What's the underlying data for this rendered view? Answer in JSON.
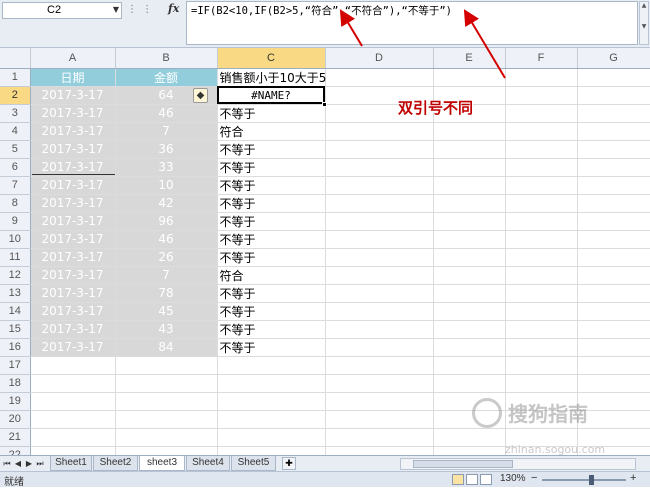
{
  "formula_bar": {
    "name_box": "C2",
    "formula": "=IF(B2<10,IF(B2>5,“符合”,“不符合”),“不等于”)",
    "fx_label": "fx"
  },
  "columns": [
    "A",
    "B",
    "C",
    "D",
    "E",
    "F",
    "G"
  ],
  "active": {
    "column": "C",
    "row": 2
  },
  "header_row": {
    "a": "日期",
    "b": "金额",
    "c": "销售额小于10大于5"
  },
  "rows": [
    {
      "num": "2",
      "date": "2017-3-17",
      "amount": "64",
      "result": "#NAME?"
    },
    {
      "num": "3",
      "date": "2017-3-17",
      "amount": "46",
      "result": "不等于"
    },
    {
      "num": "4",
      "date": "2017-3-17",
      "amount": "7",
      "result": "符合"
    },
    {
      "num": "5",
      "date": "2017-3-17",
      "amount": "36",
      "result": "不等于"
    },
    {
      "num": "6",
      "date": "2017-3-17",
      "amount": "33",
      "result": "不等于"
    },
    {
      "num": "7",
      "date": "2017-3-17",
      "amount": "10",
      "result": "不等于"
    },
    {
      "num": "8",
      "date": "2017-3-17",
      "amount": "42",
      "result": "不等于"
    },
    {
      "num": "9",
      "date": "2017-3-17",
      "amount": "96",
      "result": "不等于"
    },
    {
      "num": "10",
      "date": "2017-3-17",
      "amount": "46",
      "result": "不等于"
    },
    {
      "num": "11",
      "date": "2017-3-17",
      "amount": "26",
      "result": "不等于"
    },
    {
      "num": "12",
      "date": "2017-3-17",
      "amount": "7",
      "result": "符合"
    },
    {
      "num": "13",
      "date": "2017-3-17",
      "amount": "78",
      "result": "不等于"
    },
    {
      "num": "14",
      "date": "2017-3-17",
      "amount": "45",
      "result": "不等于"
    },
    {
      "num": "15",
      "date": "2017-3-17",
      "amount": "43",
      "result": "不等于"
    },
    {
      "num": "16",
      "date": "2017-3-17",
      "amount": "84",
      "result": "不等于"
    }
  ],
  "empty_rows": [
    "17",
    "18",
    "19",
    "20",
    "21",
    "22"
  ],
  "first_row_num": "1",
  "annotation": "双引号不同",
  "sheet_tabs": [
    "Sheet1",
    "Sheet2",
    "sheet3",
    "Sheet4",
    "Sheet5"
  ],
  "active_sheet": "sheet3",
  "status": {
    "ready": "就绪",
    "zoom": "130%",
    "zoom_minus": "−",
    "zoom_plus": "+"
  },
  "watermark": {
    "main": "搜狗指南",
    "sub": "zhinan.sogou.com"
  },
  "icons": {
    "error": "warning-diamond-icon",
    "dropdown": "chevron-down-icon",
    "new_sheet": "insert-sheet-icon"
  },
  "colors": {
    "header_fill": "#92cddc",
    "data_fill": "#d8d8d8",
    "active_header": "#f9d983",
    "annotation": "#c00000"
  }
}
